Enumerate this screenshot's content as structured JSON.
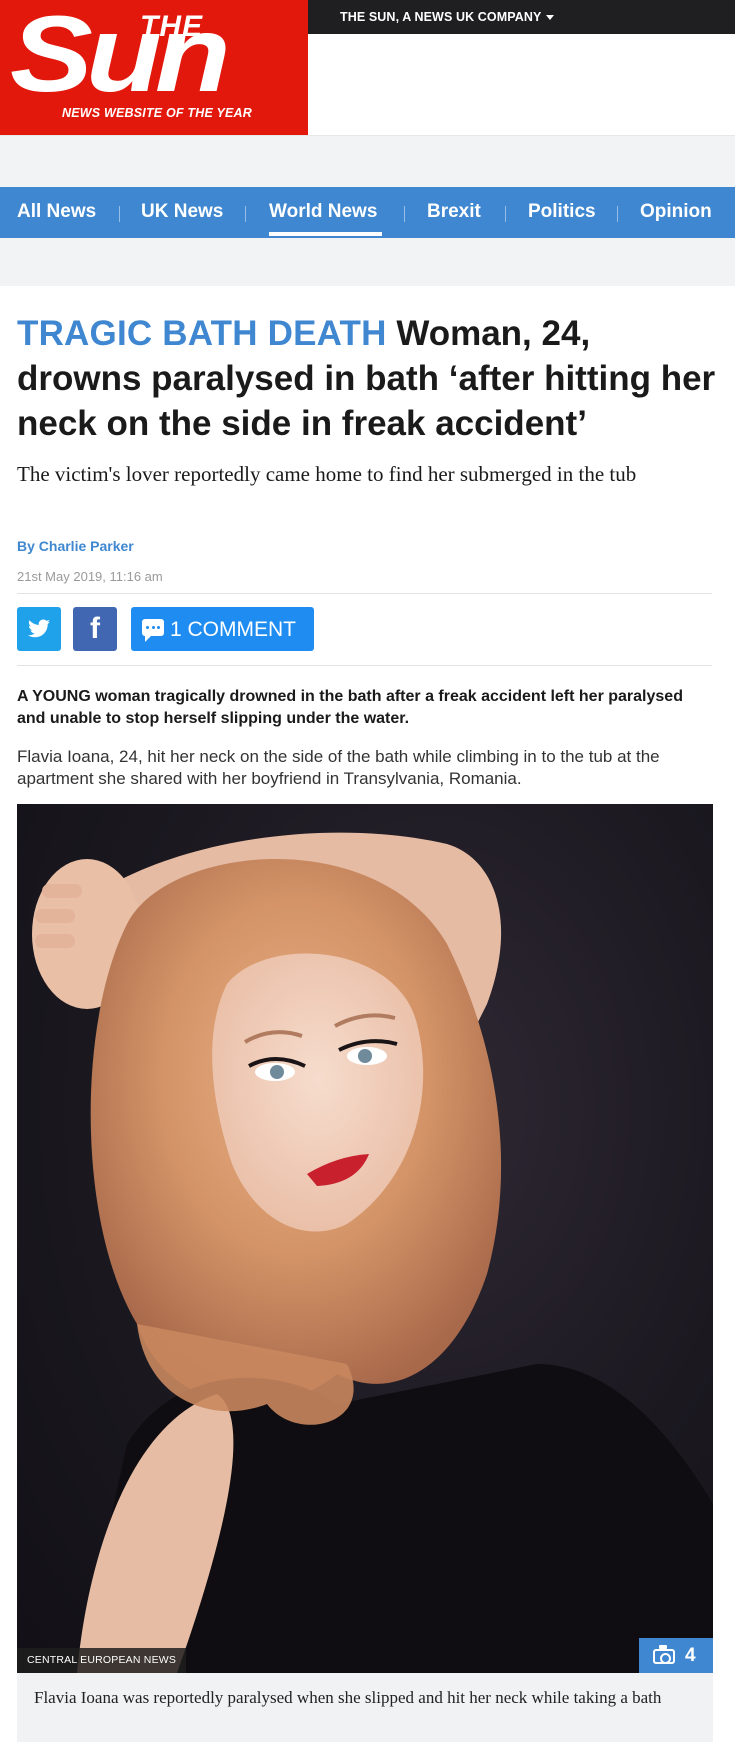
{
  "masthead": {
    "logo_the": "THE",
    "logo_sun": "Sun",
    "tagline": "NEWS WEBSITE OF THE YEAR",
    "company_link": "THE SUN, A NEWS UK COMPANY",
    "brand_red": "#e3180d",
    "topbar_bg": "#1f1f22"
  },
  "nav": {
    "items": [
      {
        "label": "All News"
      },
      {
        "label": "UK News"
      },
      {
        "label": "World News",
        "active": true
      },
      {
        "label": "Brexit"
      },
      {
        "label": "Politics"
      },
      {
        "label": "Opinion"
      }
    ],
    "bg": "#3f87d0"
  },
  "article": {
    "kicker": "TRAGIC BATH DEATH",
    "headline": "Woman, 24, drowns paralysed in bath ‘after hitting her neck on the side in freak accident’",
    "standfirst": "The victim's lover reportedly came home to find her submerged in the tub",
    "byline": "By Charlie Parker",
    "date": "21st May 2019, 11:16 am",
    "lead": "A YOUNG woman tragically drowned in the bath after a freak accident left her paralysed and unable to stop herself slipping under the water.",
    "paragraph": "Flavia Ioana, 24, hit her neck on the side of the bath while climbing in to the tub at the apartment she shared with her boyfriend in Transylvania, Romania."
  },
  "share": {
    "twitter_icon": "twitter-icon",
    "facebook_icon": "facebook-icon",
    "facebook_glyph": "f",
    "comments_label": "1 COMMENT",
    "twitter_color": "#20a2ea",
    "facebook_color": "#4267b2",
    "comments_color": "#1e8cf0"
  },
  "photo": {
    "credit": "CENTRAL EUROPEAN NEWS",
    "gallery_count": "4",
    "caption": "Flavia Ioana was reportedly paralysed when she slipped and hit her neck while taking a bath"
  }
}
